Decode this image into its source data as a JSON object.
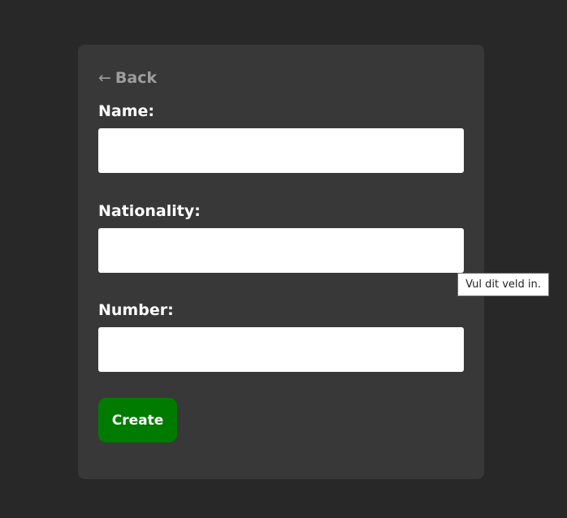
{
  "form": {
    "back_arrow": "←",
    "back_label": "Back",
    "fields": [
      {
        "label": "Name:",
        "value": ""
      },
      {
        "label": "Nationality:",
        "value": ""
      },
      {
        "label": "Number:",
        "value": ""
      }
    ],
    "create_label": "Create"
  },
  "tooltip": {
    "text": "Vul dit veld in."
  },
  "colors": {
    "page_background": "#282828",
    "card_background": "#383838",
    "create_button": "#007b00",
    "back_link": "#9e9e9e"
  }
}
